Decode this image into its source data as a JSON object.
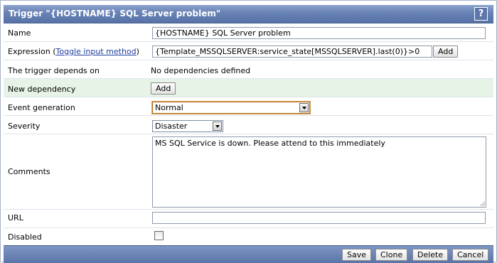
{
  "window": {
    "title": "Trigger \"{HOSTNAME} SQL Server problem\"",
    "help_label": "?"
  },
  "fields": {
    "name": {
      "label": "Name",
      "value": "{HOSTNAME} SQL Server problem"
    },
    "expression": {
      "label_prefix": "Expression (",
      "toggle_link": "Toggle input method",
      "label_suffix": ")",
      "value": "{Template_MSSQLSERVER:service_state[MSSQLSERVER].last(0)}>0",
      "add_button": "Add"
    },
    "depends_on": {
      "label": "The trigger depends on",
      "value": "No dependencies defined"
    },
    "new_dependency": {
      "label": "New dependency",
      "add_button": "Add"
    },
    "event_generation": {
      "label": "Event generation",
      "selected": "Normal"
    },
    "severity": {
      "label": "Severity",
      "selected": "Disaster"
    },
    "comments": {
      "label": "Comments",
      "value": "MS SQL Service is down. Please attend to this immediately"
    },
    "url": {
      "label": "URL",
      "value": ""
    },
    "disabled": {
      "label": "Disabled",
      "checked": false
    }
  },
  "footer": {
    "save": "Save",
    "clone": "Clone",
    "delete": "Delete",
    "cancel": "Cancel"
  },
  "colors": {
    "title_bar": "#6781b4",
    "highlight_row": "#e6f3e6",
    "focus_border": "#b06a1a"
  }
}
